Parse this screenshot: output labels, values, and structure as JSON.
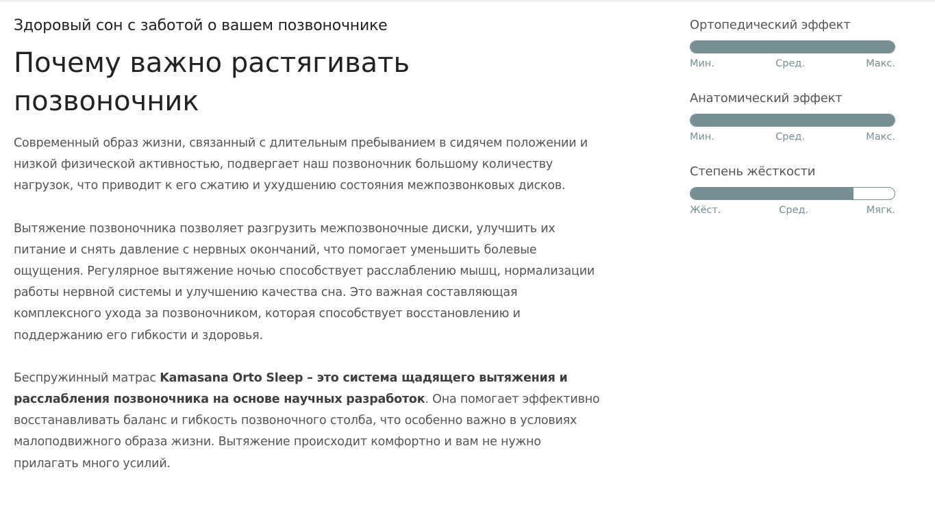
{
  "article": {
    "subtitle": "Здоровый сон с заботой о вашем позвоночнике",
    "title": "Почему важно растягивать позвоночник",
    "paragraph_1": "Современный образ жизни, связанный с длительным пребыванием в сидячем положении и низкой физической активностью, подвергает наш позвоночник большому количеству нагрузок, что приводит к его сжатию и ухудшению состояния межпозвонковых дисков.",
    "paragraph_2": "Вытяжение позвоночника позволяет разгрузить межпозвоночные диски, улучшить их питание и снять давление с нервных окончаний, что помогает уменьшить болевые ощущения. Регулярное вытяжение ночью способствует расслаблению мышц, нормализации работы нервной системы и улучшению качества сна. Это важная составляющая комплексного ухода за позвоночником, которая способствует восстановлению и поддержанию его гибкости и здоровья.",
    "paragraph_3_prefix": "Беспружинный матрас ",
    "paragraph_3_bold": "Kamasana Orto Sleep – это система щадящего вытяжения и расслабления позвоночника на основе научных разработок",
    "paragraph_3_suffix": ". Она помогает эффективно восстанавливать баланс и гибкость позвоночного столба, что особенно важно в условиях малоподвижного образа жизни. Вытяжение происходит комфортно и вам не нужно прилагать много усилий."
  },
  "metrics": [
    {
      "label": "Ортопедический эффект",
      "level": 1.0,
      "scale": [
        "Мин.",
        "Сред.",
        "Макс."
      ]
    },
    {
      "label": "Анатомический эффект",
      "level": 1.0,
      "scale": [
        "Мин.",
        "Сред.",
        "Макс."
      ]
    },
    {
      "label": "Степень жёсткости",
      "level": 0.8,
      "scale": [
        "Жёст.",
        "Сред.",
        "Мягк."
      ]
    }
  ],
  "colors": {
    "bar_fill": "#758f94",
    "text_body": "#555555",
    "text_heading": "#222222"
  }
}
